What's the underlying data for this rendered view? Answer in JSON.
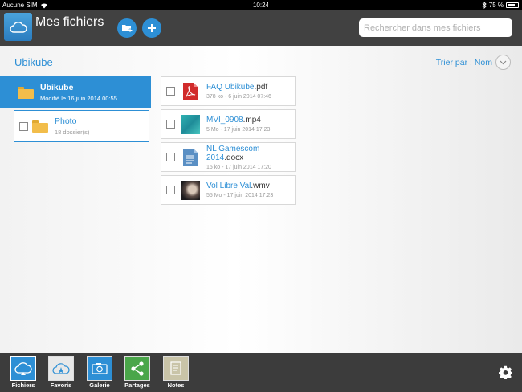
{
  "status_bar": {
    "carrier": "Aucune SIM",
    "time": "10:24",
    "battery": "75 %",
    "battery_level": 0.75
  },
  "header": {
    "title": "Mes fichiers",
    "search_placeholder": "Rechercher dans mes fichiers"
  },
  "content": {
    "breadcrumb": "Ubikube",
    "sort_label": "Trier par : Nom",
    "folders": [
      {
        "name": "Ubikube",
        "sub": "Modifié le 16 juin 2014 00:55"
      },
      {
        "name": "Photo",
        "sub": "18 dossier(s)"
      }
    ],
    "files": [
      {
        "base": "FAQ Ubikube",
        "ext": ".pdf",
        "meta": "378 ko - 6 juin 2014 07:46",
        "type": "pdf"
      },
      {
        "base": "MVI_0908",
        "ext": ".mp4",
        "meta": "5 Mo - 17 juin 2014 17:23",
        "type": "video"
      },
      {
        "base": "NL Gamescom 2014",
        "ext": ".docx",
        "meta": "15 ko - 17 juin 2014 17:20",
        "type": "doc"
      },
      {
        "base": "Vol Libre Val",
        "ext": ".wmv",
        "meta": "55 Mo - 17 juin 2014 17:23",
        "type": "video"
      }
    ]
  },
  "tabs": [
    {
      "label": "Fichiers",
      "icon": "cloud-icon",
      "color": "#2d8fd5"
    },
    {
      "label": "Favoris",
      "icon": "star-cloud-icon",
      "color": "#e8e8e8"
    },
    {
      "label": "Galerie",
      "icon": "camera-icon",
      "color": "#2d8fd5"
    },
    {
      "label": "Partages",
      "icon": "share-icon",
      "color": "#4aa64a"
    },
    {
      "label": "Notes",
      "icon": "notes-icon",
      "color": "#c9c4a8"
    }
  ],
  "colors": {
    "accent": "#2d8fd5",
    "topbar": "#414141",
    "bottombar": "#3c3c3c"
  }
}
